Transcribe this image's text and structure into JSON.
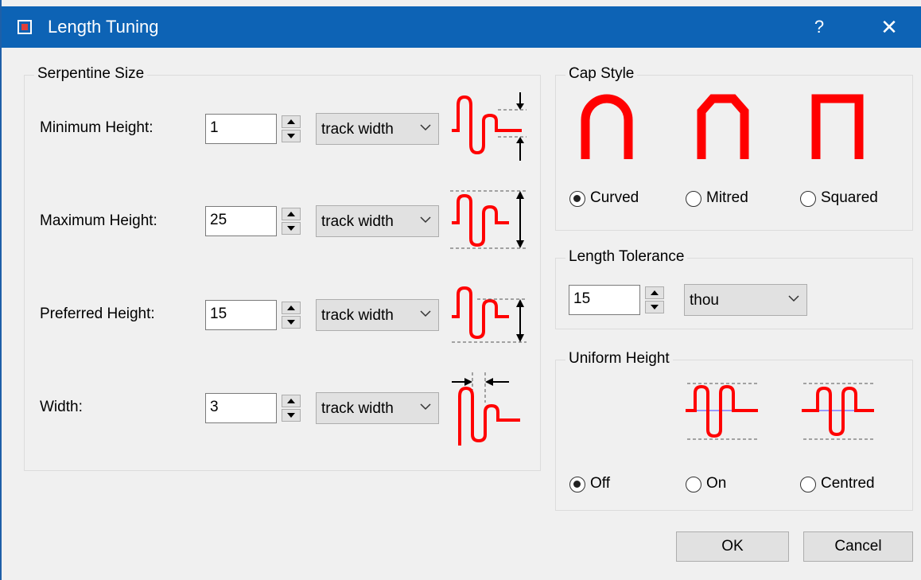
{
  "window": {
    "title": "Length Tuning",
    "help": "?",
    "close": "✕"
  },
  "serpentine": {
    "title": "Serpentine Size",
    "rows": [
      {
        "label": "Minimum Height:",
        "value": "1",
        "unit": "track width"
      },
      {
        "label": "Maximum Height:",
        "value": "25",
        "unit": "track width"
      },
      {
        "label": "Preferred Height:",
        "value": "15",
        "unit": "track width"
      },
      {
        "label": "Width:",
        "value": "3",
        "unit": "track width"
      }
    ]
  },
  "cap_style": {
    "title": "Cap Style",
    "options": [
      {
        "label": "Curved",
        "selected": true
      },
      {
        "label": "Mitred",
        "selected": false
      },
      {
        "label": "Squared",
        "selected": false
      }
    ]
  },
  "length_tolerance": {
    "title": "Length Tolerance",
    "value": "15",
    "unit": "thou"
  },
  "uniform_height": {
    "title": "Uniform Height",
    "options": [
      {
        "label": "Off",
        "selected": true
      },
      {
        "label": "On",
        "selected": false
      },
      {
        "label": "Centred",
        "selected": false
      }
    ]
  },
  "buttons": {
    "ok": "OK",
    "cancel": "Cancel"
  },
  "colors": {
    "titlebar": "#0d63b5",
    "accent_red": "#ff0000"
  }
}
